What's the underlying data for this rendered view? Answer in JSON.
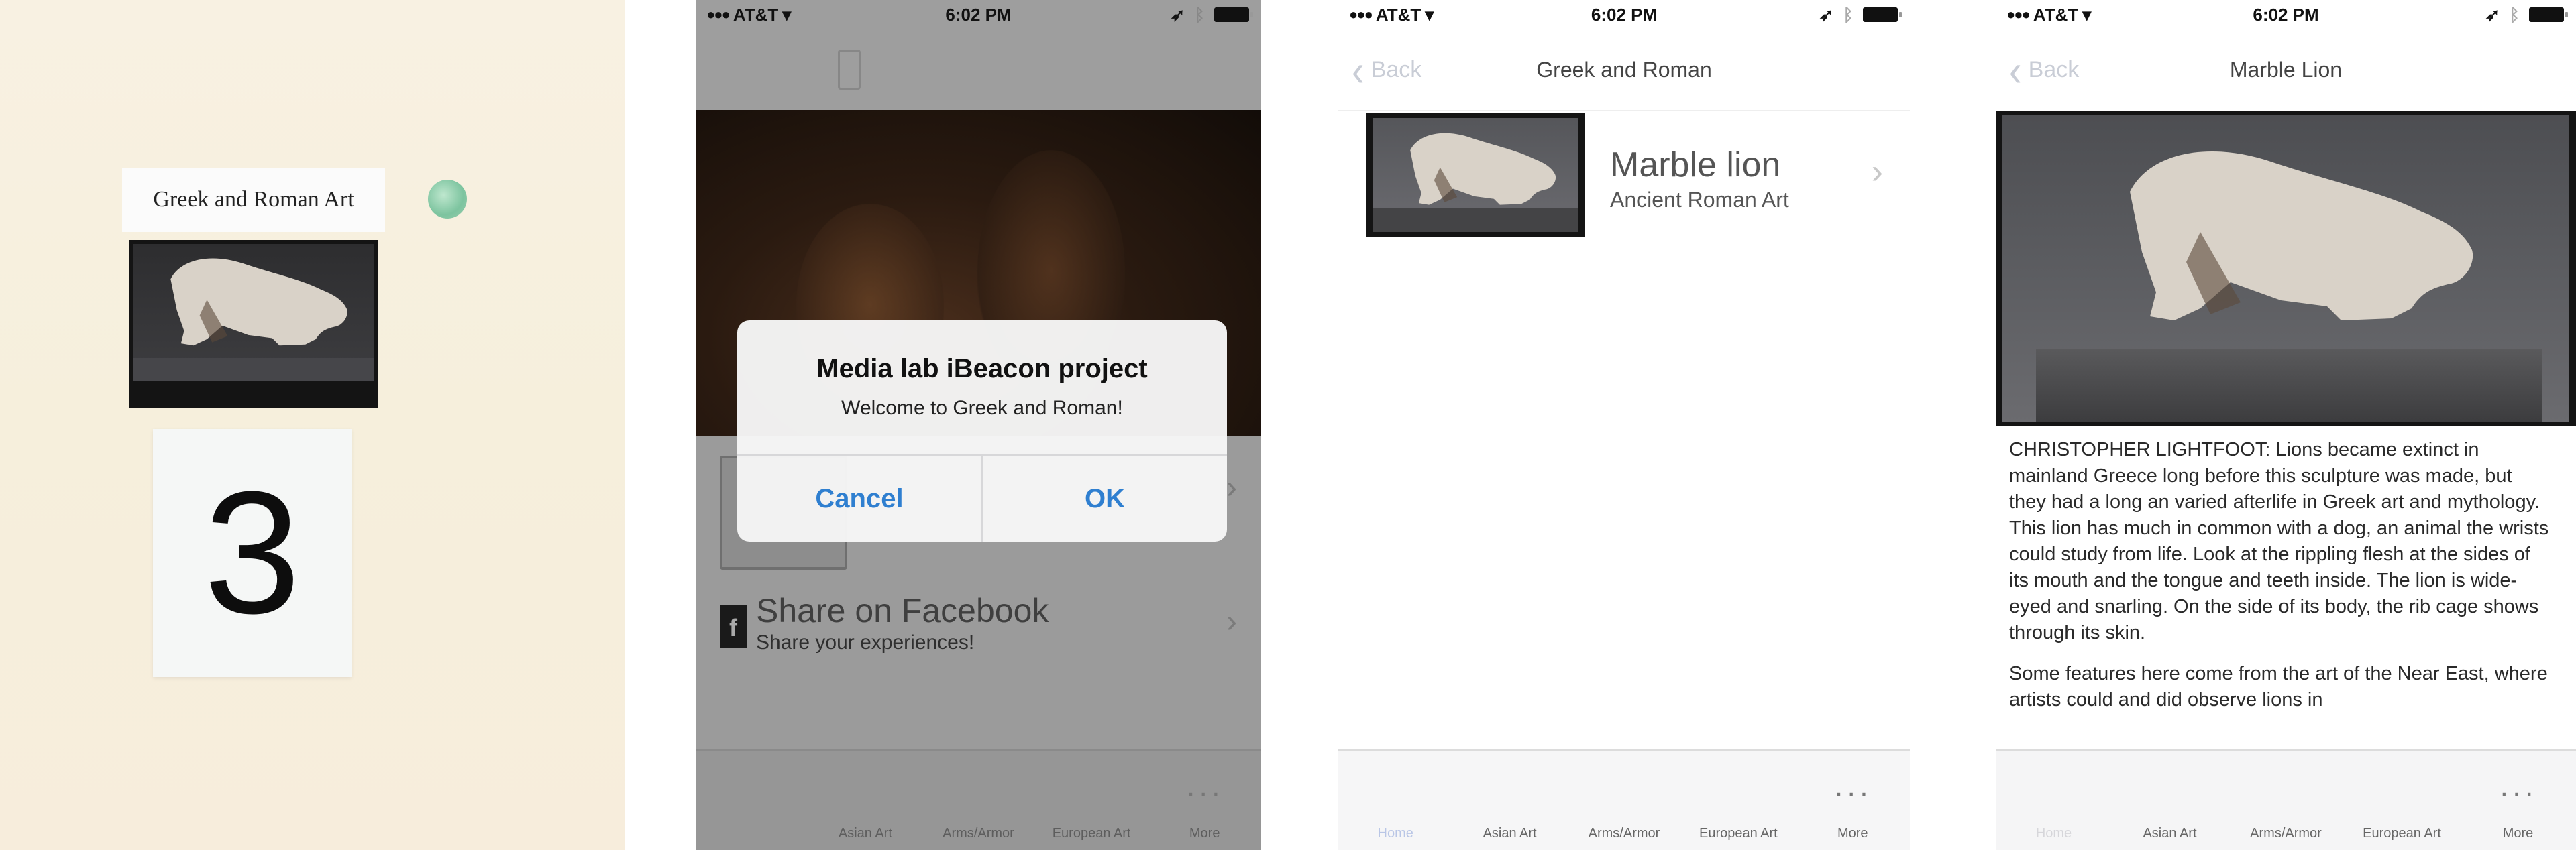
{
  "photo_panel": {
    "sign_label": "Greek and Roman Art",
    "sign_number": "3"
  },
  "status_bar": {
    "carrier": "AT&T",
    "signal_dots": "●●●",
    "time": "6:02 PM"
  },
  "tab_bar": {
    "tabs": [
      {
        "label": "Home",
        "icon": "home-icon"
      },
      {
        "label": "Asian Art",
        "icon": "museum-icon"
      },
      {
        "label": "Arms/Armor",
        "icon": "museum-icon"
      },
      {
        "label": "European Art",
        "icon": "museum-icon"
      },
      {
        "label": "More",
        "icon": "more-icon"
      }
    ]
  },
  "alert_screen": {
    "alert": {
      "title": "Media lab iBeacon project",
      "message": "Welcome to Greek and Roman!",
      "cancel_label": "Cancel",
      "ok_label": "OK"
    },
    "facebook_row": {
      "icon_glyph": "f",
      "title": "Share on Facebook",
      "subtitle": "Share your experiences!"
    }
  },
  "list_screen": {
    "back_label": "Back",
    "title": "Greek and Roman",
    "items": [
      {
        "name": "Marble lion",
        "category": "Ancient Roman Art"
      }
    ]
  },
  "detail_screen": {
    "back_label": "Back",
    "title": "Marble Lion",
    "paragraphs": [
      "CHRISTOPHER LIGHTFOOT: Lions became extinct in mainland Greece long before this sculpture was made, but they had a long an varied afterlife in Greek art and mythology. This lion has much in common with a dog, an animal the wrists could study from life. Look at the rippling flesh at the sides of its mouth and the tongue and teeth inside. The lion is wide-eyed and snarling. On the side of its body, the rib cage shows through its skin.",
      "Some features here come from the art of the Near East, where artists could and did observe lions in"
    ]
  },
  "colors": {
    "ios_blue": "#2f7fd0",
    "wall": "#f7efdd",
    "dim_overlay": "#9b9b9b"
  }
}
